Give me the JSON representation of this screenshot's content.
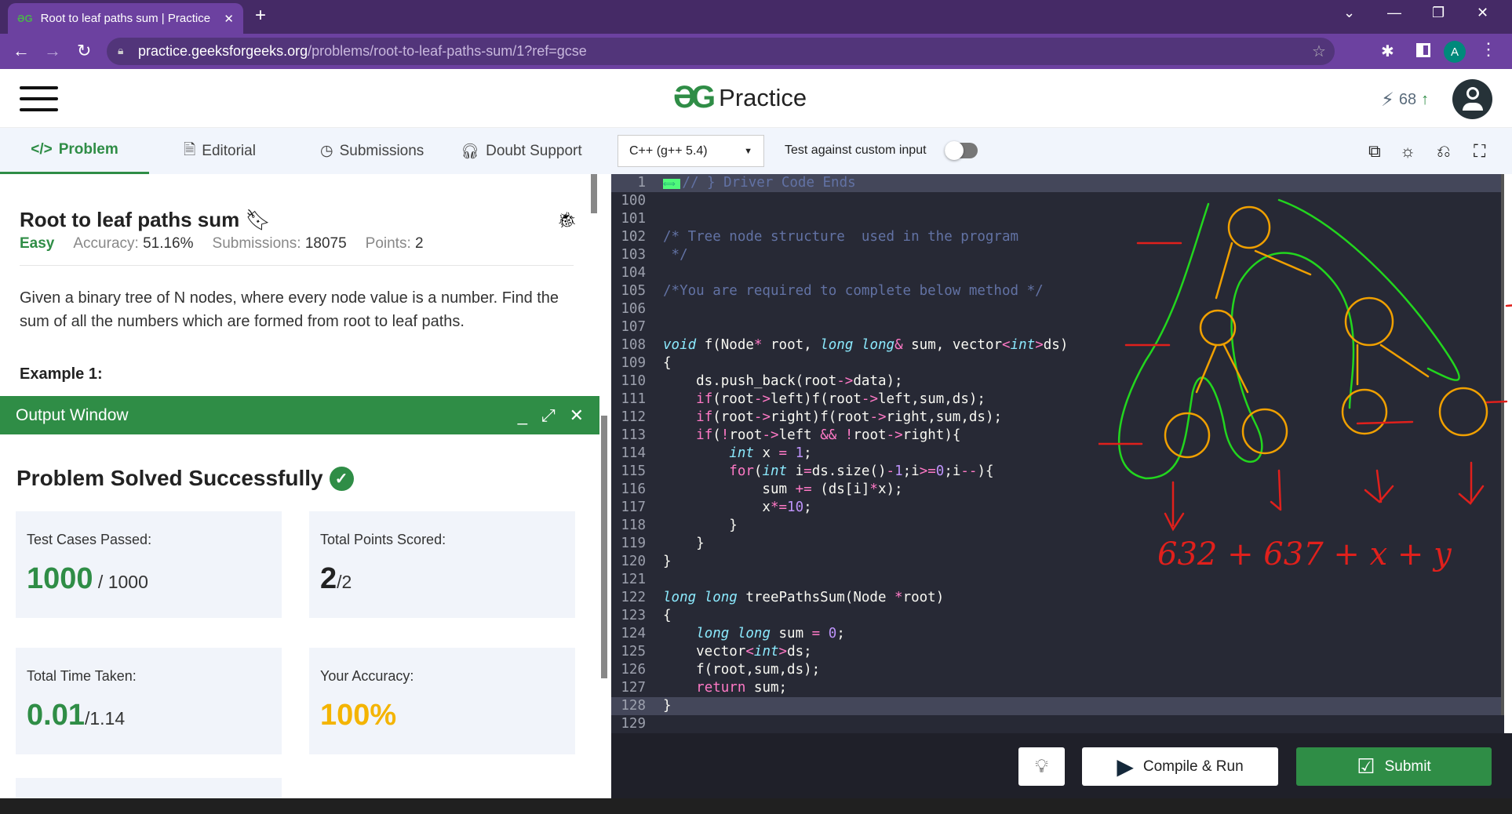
{
  "browser": {
    "tab_title": "Root to leaf paths sum | Practice",
    "url_host": "practice.geeksforgeeks.org",
    "url_path": "/problems/root-to-leaf-paths-sum/1?ref=gcse",
    "profile_initial": "A"
  },
  "site": {
    "logo_text": "Practice",
    "streak": "68"
  },
  "tabs": [
    {
      "label": "Problem",
      "icon": "code-icon"
    },
    {
      "label": "Editorial",
      "icon": "document-icon"
    },
    {
      "label": "Submissions",
      "icon": "clock-icon"
    },
    {
      "label": "Doubt Support",
      "icon": "headset-icon"
    }
  ],
  "editor_toolbar": {
    "language": "C++ (g++ 5.4)",
    "custom_input_label": "Test against custom input",
    "custom_input_enabled": false
  },
  "problem": {
    "title": "Root to leaf paths sum",
    "difficulty": "Easy",
    "accuracy_label": "Accuracy:",
    "accuracy": "51.16%",
    "submissions_label": "Submissions:",
    "submissions": "18075",
    "points_label": "Points:",
    "points": "2",
    "description": "Given a binary tree of N nodes, where every node value is a number. Find the sum of all the numbers which are formed from root to leaf paths.",
    "example_heading": "Example 1:"
  },
  "output": {
    "title": "Output Window",
    "status": "Problem Solved Successfully",
    "cards": [
      {
        "label": "Test Cases Passed:",
        "value": "1000",
        "total": " / 1000",
        "color": "#2f8d46"
      },
      {
        "label": "Total Points Scored:",
        "value": "2",
        "total": "/2",
        "color": "#222222"
      },
      {
        "label": "Total Time Taken:",
        "value": "0.01",
        "total": "/1.14",
        "color": "#2f8d46"
      },
      {
        "label": "Your Accuracy:",
        "value": "100%",
        "total": "",
        "color": "#f4b400"
      }
    ]
  },
  "code": [
    {
      "n": "1",
      "t": [
        [
          "// } Driver Code Ends",
          "com"
        ]
      ],
      "fold": true
    },
    {
      "n": "100",
      "t": []
    },
    {
      "n": "101",
      "t": []
    },
    {
      "n": "102",
      "t": [
        [
          "/* Tree node structure  used in the program",
          "com"
        ]
      ]
    },
    {
      "n": "103",
      "t": [
        [
          " */",
          "com"
        ]
      ]
    },
    {
      "n": "104",
      "t": []
    },
    {
      "n": "105",
      "t": [
        [
          "/*You are required to complete below method */",
          "com"
        ]
      ]
    },
    {
      "n": "106",
      "t": []
    },
    {
      "n": "107",
      "t": []
    },
    {
      "n": "108",
      "t": [
        [
          "void",
          "type"
        ],
        [
          " f(Node",
          ""
        ],
        [
          "*",
          "op"
        ],
        [
          " root, ",
          ""
        ],
        [
          "long long",
          "type"
        ],
        [
          "&",
          "op"
        ],
        [
          " sum, vector",
          ""
        ],
        [
          "<",
          "op"
        ],
        [
          "int",
          "type"
        ],
        [
          ">",
          "op"
        ],
        [
          "ds)",
          ""
        ]
      ]
    },
    {
      "n": "109",
      "t": [
        [
          "{",
          ""
        ]
      ]
    },
    {
      "n": "110",
      "t": [
        [
          "    ds.push_back(root",
          ""
        ],
        [
          "->",
          "op"
        ],
        [
          "data);",
          ""
        ]
      ]
    },
    {
      "n": "111",
      "t": [
        [
          "    ",
          ""
        ],
        [
          "if",
          "kw"
        ],
        [
          "(root",
          ""
        ],
        [
          "->",
          "op"
        ],
        [
          "left)f(root",
          ""
        ],
        [
          "->",
          "op"
        ],
        [
          "left,sum,ds);",
          ""
        ]
      ]
    },
    {
      "n": "112",
      "t": [
        [
          "    ",
          ""
        ],
        [
          "if",
          "kw"
        ],
        [
          "(root",
          ""
        ],
        [
          "->",
          "op"
        ],
        [
          "right)f(root",
          ""
        ],
        [
          "->",
          "op"
        ],
        [
          "right,sum,ds);",
          ""
        ]
      ]
    },
    {
      "n": "113",
      "t": [
        [
          "    ",
          ""
        ],
        [
          "if",
          "kw"
        ],
        [
          "(",
          ""
        ],
        [
          "!",
          "op"
        ],
        [
          "root",
          ""
        ],
        [
          "->",
          "op"
        ],
        [
          "left ",
          ""
        ],
        [
          "&&",
          "op"
        ],
        [
          " ",
          ""
        ],
        [
          "!",
          "op"
        ],
        [
          "root",
          ""
        ],
        [
          "->",
          "op"
        ],
        [
          "right){",
          ""
        ]
      ]
    },
    {
      "n": "114",
      "t": [
        [
          "        ",
          ""
        ],
        [
          "int",
          "type"
        ],
        [
          " x ",
          ""
        ],
        [
          "=",
          "op"
        ],
        [
          " ",
          ""
        ],
        [
          "1",
          "num"
        ],
        [
          ";",
          ""
        ]
      ]
    },
    {
      "n": "115",
      "t": [
        [
          "        ",
          ""
        ],
        [
          "for",
          "kw"
        ],
        [
          "(",
          ""
        ],
        [
          "int",
          "type"
        ],
        [
          " i",
          ""
        ],
        [
          "=",
          "op"
        ],
        [
          "ds.size()",
          ""
        ],
        [
          "-",
          "op"
        ],
        [
          "1",
          "num"
        ],
        [
          ";i",
          ""
        ],
        [
          ">=",
          "op"
        ],
        [
          "0",
          "num"
        ],
        [
          ";i",
          ""
        ],
        [
          "--",
          "op"
        ],
        [
          "){",
          ""
        ]
      ]
    },
    {
      "n": "116",
      "t": [
        [
          "            sum ",
          ""
        ],
        [
          "+=",
          "op"
        ],
        [
          " (ds[i]",
          ""
        ],
        [
          "*",
          "op"
        ],
        [
          "x);",
          ""
        ]
      ]
    },
    {
      "n": "117",
      "t": [
        [
          "            x",
          ""
        ],
        [
          "*=",
          "op"
        ],
        [
          "10",
          "num"
        ],
        [
          ";",
          ""
        ]
      ]
    },
    {
      "n": "118",
      "t": [
        [
          "        }",
          ""
        ]
      ]
    },
    {
      "n": "119",
      "t": [
        [
          "    }",
          ""
        ]
      ]
    },
    {
      "n": "120",
      "t": [
        [
          "}",
          ""
        ]
      ]
    },
    {
      "n": "121",
      "t": []
    },
    {
      "n": "122",
      "t": [
        [
          "long long",
          "type"
        ],
        [
          " treePathsSum(Node ",
          ""
        ],
        [
          "*",
          "op"
        ],
        [
          "root)",
          ""
        ]
      ]
    },
    {
      "n": "123",
      "t": [
        [
          "{",
          ""
        ]
      ]
    },
    {
      "n": "124",
      "t": [
        [
          "    ",
          ""
        ],
        [
          "long long",
          "type"
        ],
        [
          " sum ",
          ""
        ],
        [
          "=",
          "op"
        ],
        [
          " ",
          ""
        ],
        [
          "0",
          "num"
        ],
        [
          ";",
          ""
        ]
      ]
    },
    {
      "n": "125",
      "t": [
        [
          "    vector",
          ""
        ],
        [
          "<",
          "op"
        ],
        [
          "int",
          "type"
        ],
        [
          ">",
          "op"
        ],
        [
          "ds;",
          ""
        ]
      ]
    },
    {
      "n": "126",
      "t": [
        [
          "    f(root,sum,ds);",
          ""
        ]
      ]
    },
    {
      "n": "127",
      "t": [
        [
          "    ",
          ""
        ],
        [
          "return",
          "kw"
        ],
        [
          " sum;",
          ""
        ]
      ]
    },
    {
      "n": "128",
      "t": [
        [
          "}",
          ""
        ]
      ],
      "active": true
    },
    {
      "n": "129",
      "t": []
    }
  ],
  "buttons": {
    "compile_run": "Compile & Run",
    "submit": "Submit"
  },
  "annotation_text": "632 + 637 + x + y",
  "colors": {
    "brand": "#2f8d46",
    "browser": "#6c41a0",
    "editor_bg": "#272935",
    "annotation_red": "#e0201c",
    "annotation_green": "#22d61e",
    "annotation_orange": "#f0a000"
  }
}
